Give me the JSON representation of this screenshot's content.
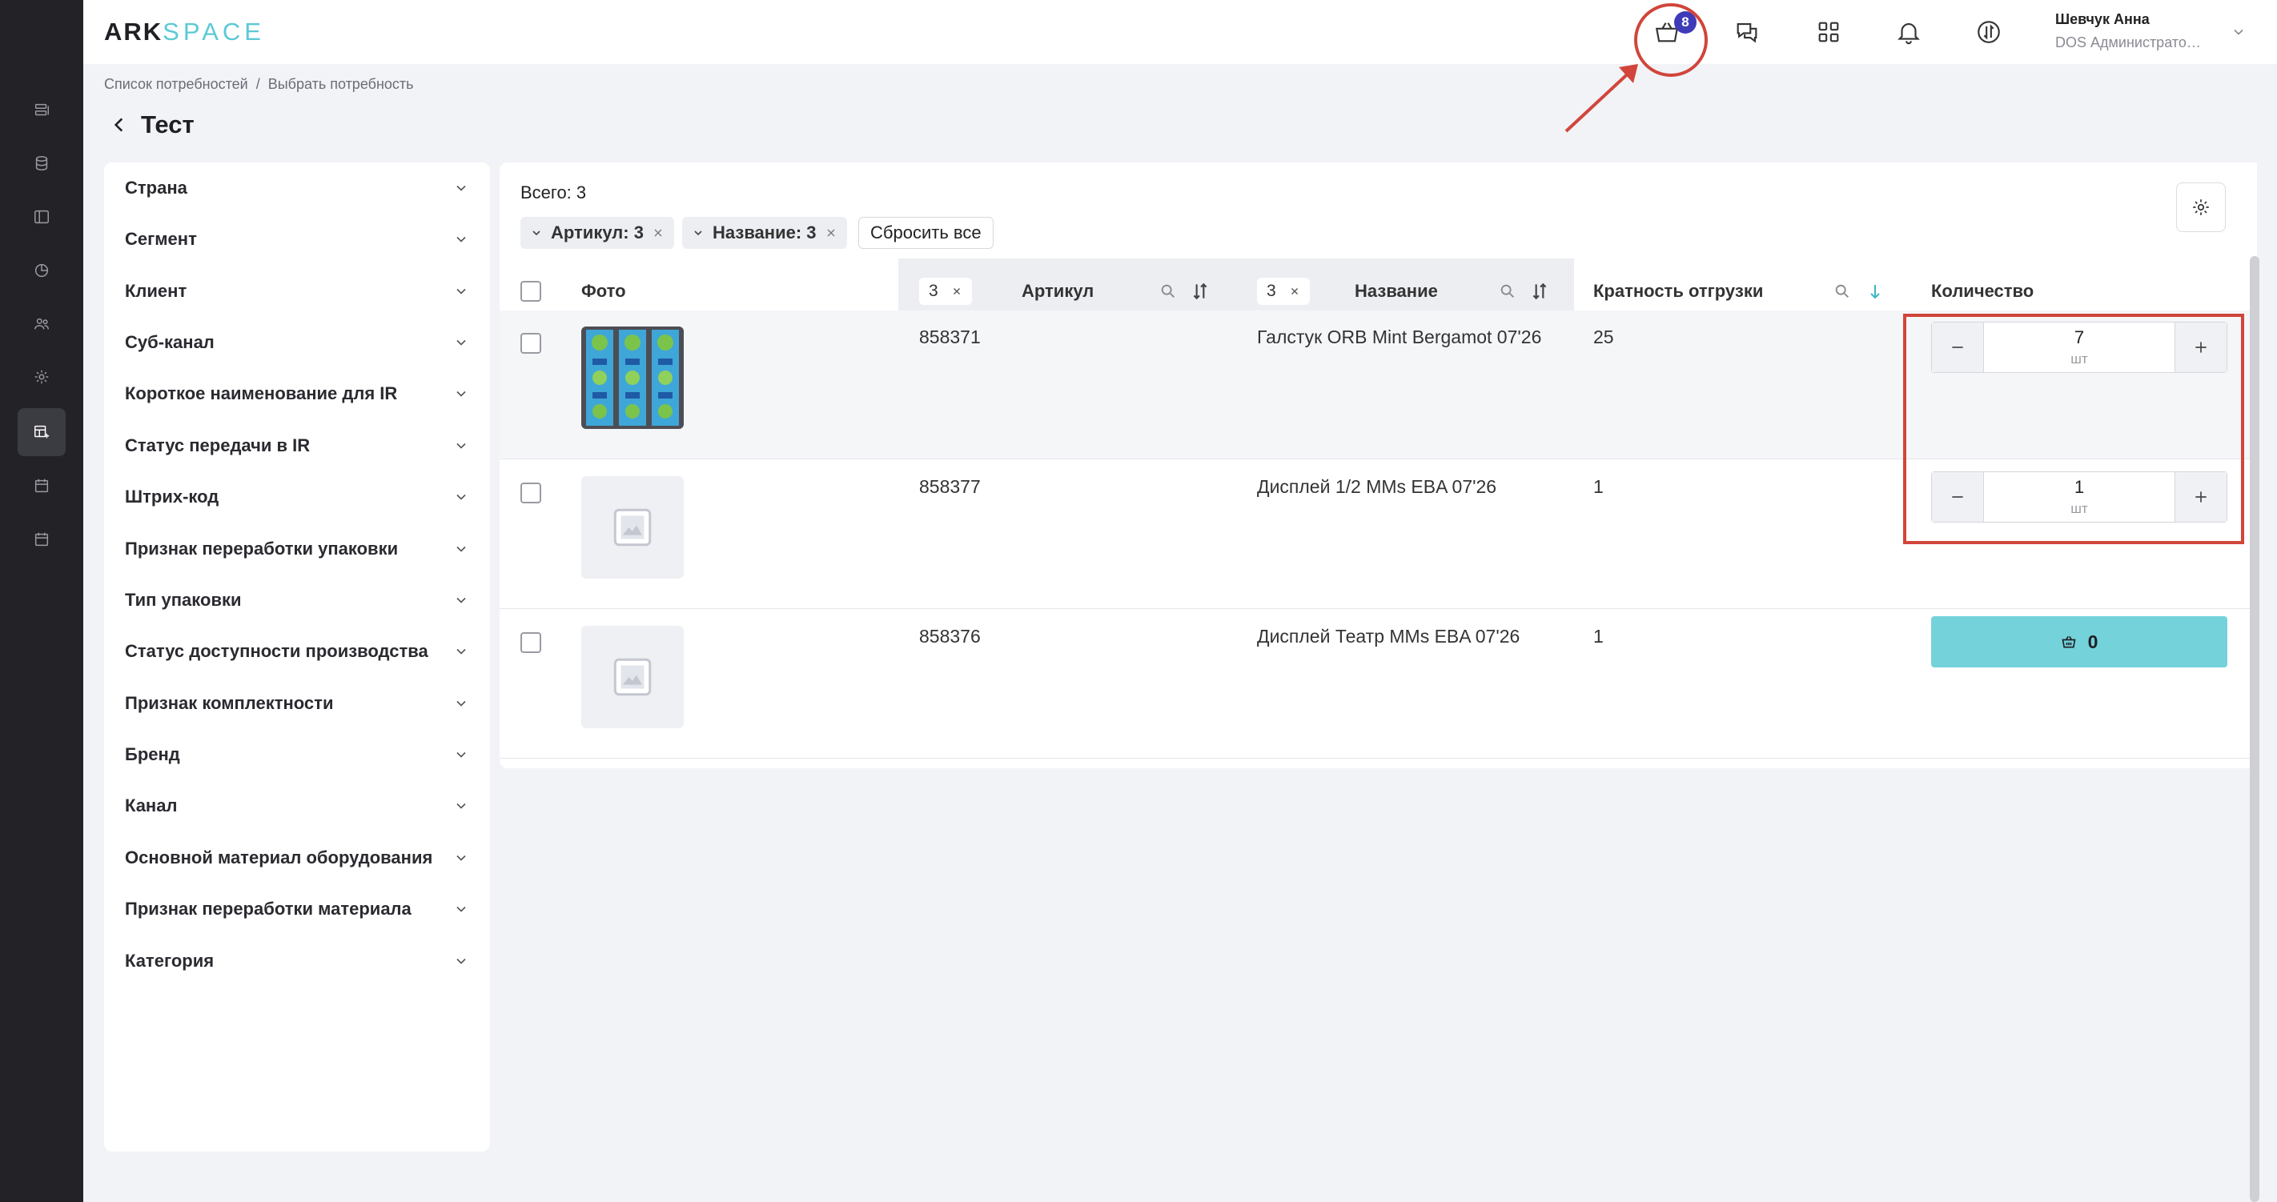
{
  "logo": {
    "ark": "ARK",
    "space": "SPACE"
  },
  "header": {
    "cart_count": "8",
    "user_name": "Шевчук Анна",
    "user_role": "DOS Администратор…"
  },
  "breadcrumb": {
    "first": "Список потребностей",
    "separator": "/",
    "second": "Выбрать потребность"
  },
  "page_title": "Тест",
  "filters": [
    "Страна",
    "Сегмент",
    "Клиент",
    "Суб-канал",
    "Короткое наименование для IR",
    "Статус передачи в IR",
    "Штрих-код",
    "Признак переработки упаковки",
    "Тип упаковки",
    "Статус доступности производства",
    "Признак комплектности",
    "Бренд",
    "Канал",
    "Основной материал оборудования",
    "Признак переработки материала",
    "Категория"
  ],
  "summary": {
    "total": "Всего: 3"
  },
  "chips": {
    "article": "Артикул: 3",
    "name": "Название: 3",
    "reset": "Сбросить все"
  },
  "columns": {
    "photo": "Фото",
    "article_count": "3",
    "article": "Артикул",
    "name_count": "3",
    "name": "Название",
    "multiplicity": "Кратность отгрузки",
    "quantity": "Количество"
  },
  "rows": [
    {
      "article": "858371",
      "name": "Галстук ORB Mint Bergamot 07'26",
      "multiplicity": "25",
      "qty": "7",
      "unit": "шт"
    },
    {
      "article": "858377",
      "name": "Дисплей 1/2 MMs EBA 07'26",
      "multiplicity": "1",
      "qty": "1",
      "unit": "шт"
    },
    {
      "article": "858376",
      "name": "Дисплей Театр MMs EBA 07'26",
      "multiplicity": "1",
      "cart_value": "0"
    }
  ],
  "colors": {
    "accent": "#74d2da",
    "badge": "#3f3bb8",
    "annotation": "#d1453b",
    "rail": "#232327"
  },
  "icons": [
    "cart-icon",
    "help-chat-icon",
    "apps-grid-icon",
    "bell-icon",
    "sync-icon",
    "gear-icon",
    "search-icon",
    "sort-icon",
    "sort-down-icon",
    "image-placeholder-icon"
  ]
}
